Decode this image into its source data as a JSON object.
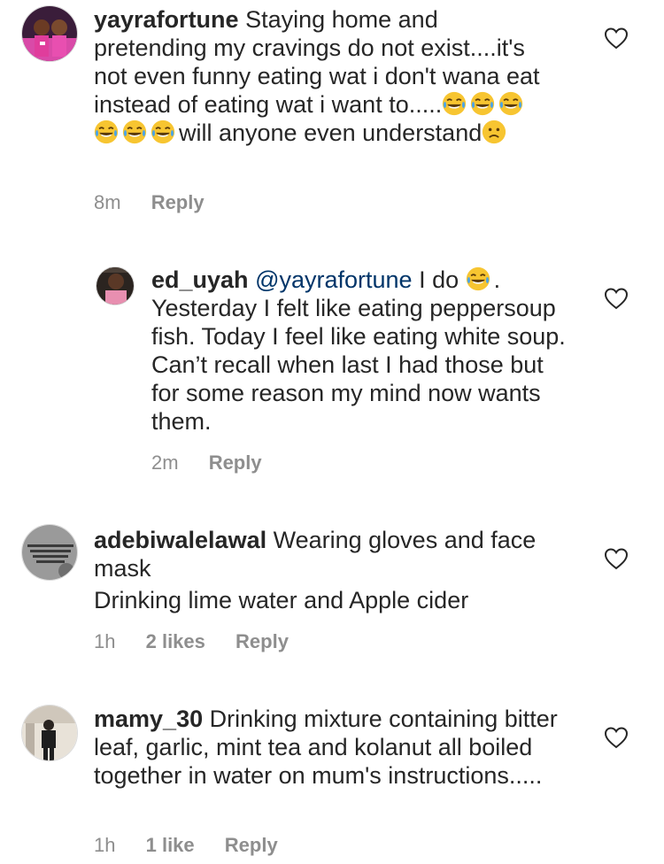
{
  "comments": [
    {
      "username": "yayrafortune",
      "text_1": " Staying home and pretending my cravings do not exist....it's not even funny eating wat i don't wana eat instead of eating wat i want to.....",
      "text_2": "will anyone even understand",
      "time": "8m",
      "reply": "Reply"
    },
    {
      "username": "ed_uyah",
      "mention": "@yayrafortune",
      "text_1": " I do ",
      "text_2": ". Yesterday I felt like eating peppersoup fish. Today I feel like eating white soup. Can’t recall when last I had those but for some reason my mind now wants them.",
      "time": "2m",
      "reply": "Reply"
    },
    {
      "username": "adebiwalelawal",
      "text_1": " Wearing gloves and face mask",
      "text_2": "Drinking lime water and Apple cider",
      "time": "1h",
      "likes": "2 likes",
      "reply": "Reply"
    },
    {
      "username": "mamy_30",
      "text_1": " Drinking mixture containing bitter leaf, garlic, mint tea and kolanut all boiled together in water on mum's instructions.....",
      "time": "1h",
      "likes": "1 like",
      "reply": "Reply"
    }
  ],
  "icons": {
    "like": "heart-outline-icon",
    "laugh": "tears-of-joy-emoji",
    "sad": "confused-face-emoji"
  },
  "colors": {
    "text": "#262626",
    "meta": "#8e8e8e",
    "mention": "#003569",
    "emoji": "#f7c531"
  }
}
